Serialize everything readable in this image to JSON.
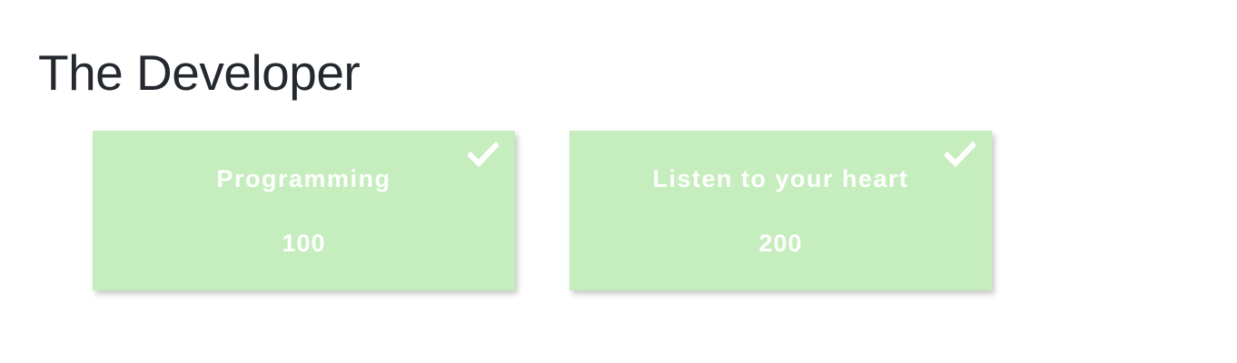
{
  "page": {
    "title": "The Developer"
  },
  "colors": {
    "title_text": "#24282f",
    "card_background": "#c5edbd",
    "card_text": "#ffffff"
  },
  "cards": [
    {
      "title": "Programming",
      "points": "100",
      "completed": true,
      "icon": "check-icon"
    },
    {
      "title": "Listen to your heart",
      "points": "200",
      "completed": true,
      "icon": "check-icon"
    }
  ]
}
